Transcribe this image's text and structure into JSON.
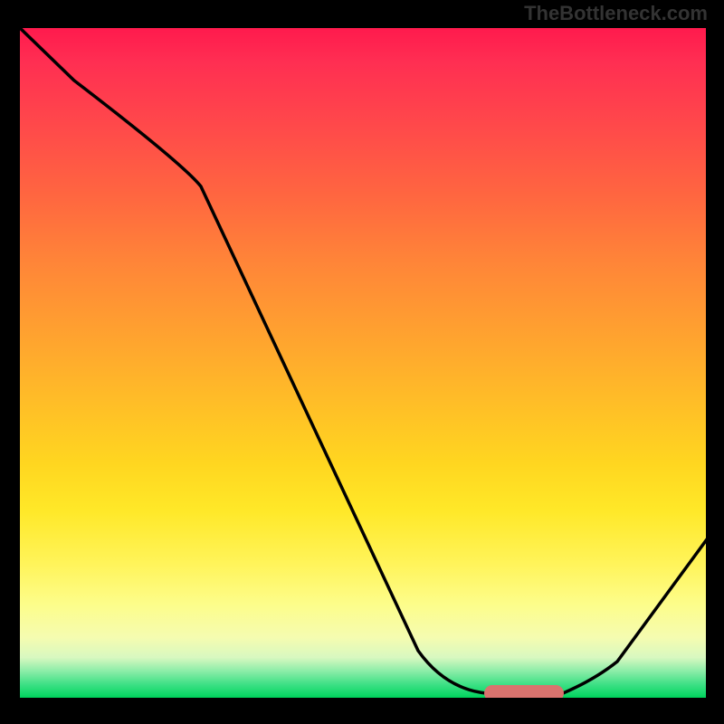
{
  "attribution": "TheBottleneck.com",
  "chart_data": {
    "type": "line",
    "title": "",
    "xlabel": "",
    "ylabel": "",
    "x": [
      0,
      24,
      58,
      68,
      79,
      86,
      100
    ],
    "values": [
      100,
      80,
      7,
      0,
      0,
      5,
      26
    ],
    "ylim": [
      0,
      100
    ],
    "annotations": [
      {
        "type": "marker",
        "x_range": [
          68,
          79
        ],
        "y": 0,
        "color": "#d9736e"
      }
    ]
  }
}
